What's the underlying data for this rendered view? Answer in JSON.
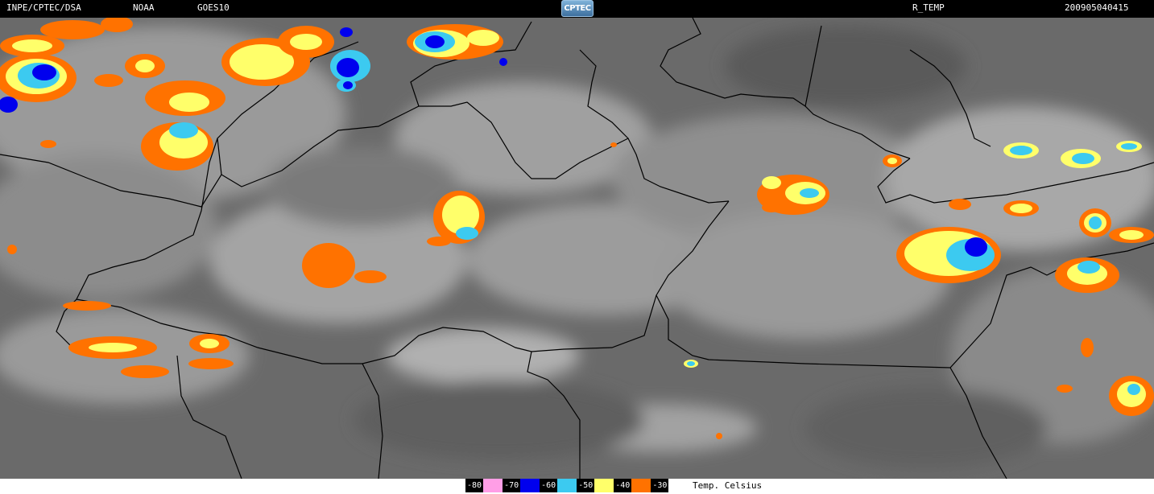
{
  "header": {
    "org": "INPE/CPTEC/DSA",
    "agency": "NOAA",
    "satellite": "GOES10",
    "logo_text": "CPTEC",
    "product": "R_TEMP",
    "timestamp": "200905040415"
  },
  "map": {
    "imagery": "infrared-satellite-enhanced",
    "cloud_palette": {
      "minus80": "#ff9ee6",
      "minus70": "#0000ee",
      "minus60": "#00008c",
      "minus50": "#3ccaf0",
      "minus40": "#ffff6a",
      "minus30": "#ff7200"
    },
    "background_gray": "#6a6a6a",
    "border_color": "#000000"
  },
  "legend": {
    "items": [
      {
        "label": "-80",
        "color": "#ff9ee6"
      },
      {
        "label": "-70",
        "color": "#0000ee"
      },
      {
        "label": "-60",
        "color": "#3ccaf0"
      },
      {
        "label": "-50",
        "color": "#ffff6a"
      },
      {
        "label": "-40",
        "color": "#ff7200"
      },
      {
        "label": "-30",
        "color": "#ffffff"
      }
    ],
    "unit": "Temp. Celsius"
  }
}
